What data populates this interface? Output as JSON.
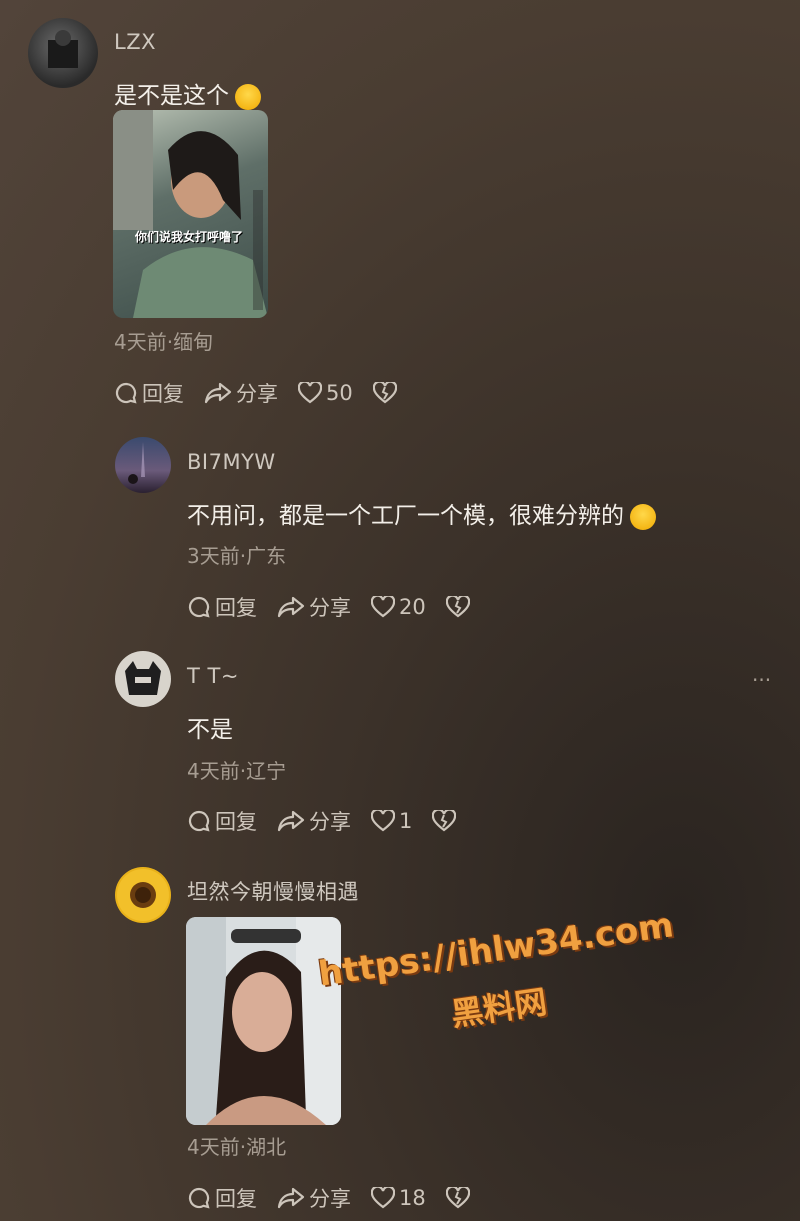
{
  "comments": [
    {
      "user": "LZX",
      "text": "是不是这个",
      "meta": "4天前·缅甸",
      "reply": "回复",
      "share": "分享",
      "likes": "50",
      "thumb_caption": "你们说我女打呼噜了"
    },
    {
      "user": "BI7MYW",
      "text": "不用问，都是一个工厂一个模，很难分辨的",
      "meta": "3天前·广东",
      "reply": "回复",
      "share": "分享",
      "likes": "20"
    },
    {
      "user": "T T~",
      "text": "不是",
      "meta": "4天前·辽宁",
      "reply": "回复",
      "share": "分享",
      "likes": "1"
    },
    {
      "user": "坦然今朝慢慢相遇",
      "meta": "4天前·湖北",
      "reply": "回复",
      "share": "分享",
      "likes": "18"
    }
  ],
  "more": "···",
  "watermark": {
    "url": "https://ihlw34.com",
    "site": "黑料网"
  },
  "icons": [
    "reply-icon",
    "share-icon",
    "heart-icon",
    "broken-heart-icon",
    "more-icon"
  ]
}
